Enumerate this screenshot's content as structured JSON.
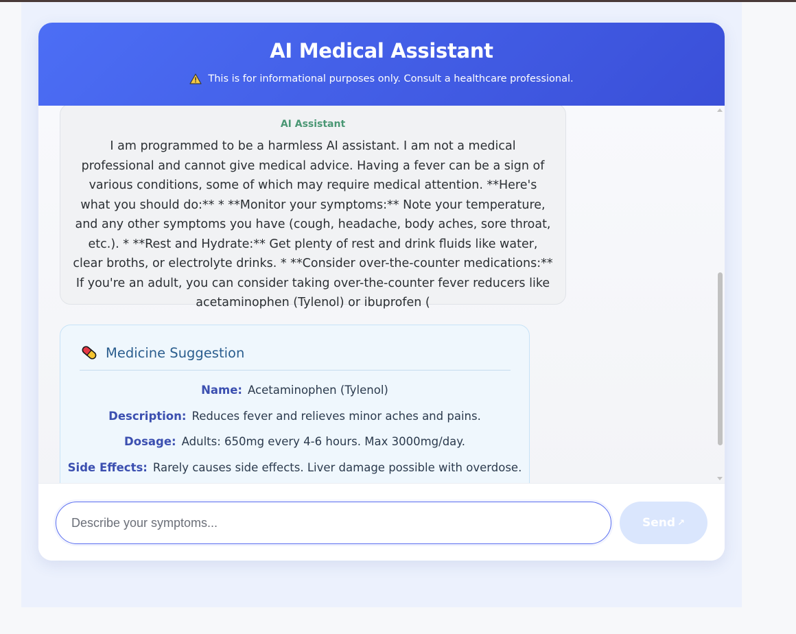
{
  "header": {
    "title": "AI Medical Assistant",
    "disclaimer": "This is for informational purposes only. Consult a healthcare professional.",
    "warning_icon": "warning-triangle-icon"
  },
  "messages": {
    "ai_message": {
      "sender": "AI Assistant",
      "text": "I am programmed to be a harmless AI assistant. I am not a medical professional and cannot give medical advice. Having a fever can be a sign of various conditions, some of which may require medical attention. **Here's what you should do:** * **Monitor your symptoms:** Note your temperature, and any other symptoms you have (cough, headache, body aches, sore throat, etc.). * **Rest and Hydrate:** Get plenty of rest and drink fluids like water, clear broths, or electrolyte drinks. * **Consider over-the-counter medications:** If you're an adult, you can consider taking over-the-counter fever reducers like acetaminophen (Tylenol) or ibuprofen ("
    },
    "medicine_card": {
      "icon": "pill-icon",
      "title": "Medicine Suggestion",
      "fields": [
        {
          "label": "Name:",
          "value": "Acetaminophen (Tylenol)"
        },
        {
          "label": "Description:",
          "value": "Reduces fever and relieves minor aches and pains."
        },
        {
          "label": "Dosage:",
          "value": "Adults: 650mg every 4-6 hours. Max 3000mg/day."
        },
        {
          "label": "Side Effects:",
          "value": "Rarely causes side effects. Liver damage possible with overdose."
        }
      ]
    }
  },
  "input": {
    "placeholder": "Describe your symptoms...",
    "value": ""
  },
  "send_button": {
    "label": "Send",
    "arrow": "↗"
  },
  "colors": {
    "header_start": "#4c6ef5",
    "header_end": "#3a4fd8",
    "sender_green": "#4a9774",
    "label_blue": "#3b4fb0",
    "send_disabled": "#dae6fd"
  }
}
